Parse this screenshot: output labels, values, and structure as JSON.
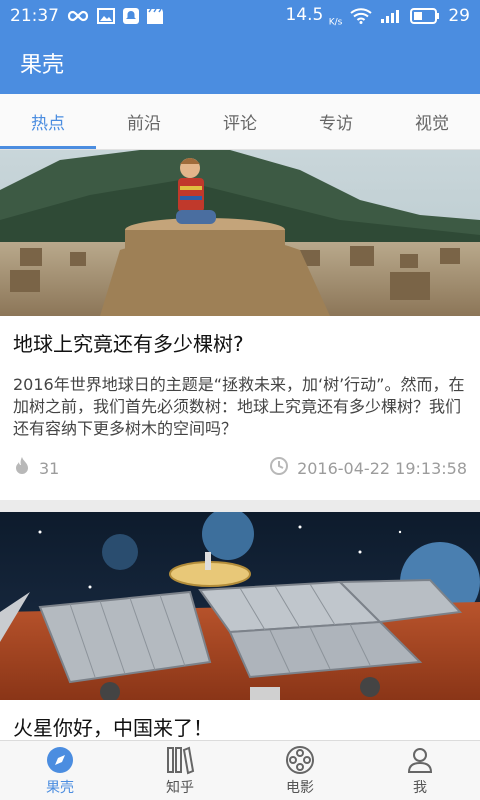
{
  "status": {
    "time": "21:37",
    "speed": "14.5",
    "speed_unit": "K/s",
    "battery": "29"
  },
  "app": {
    "title": "果壳"
  },
  "tabs": [
    {
      "label": "热点"
    },
    {
      "label": "前沿"
    },
    {
      "label": "评论"
    },
    {
      "label": "专访"
    },
    {
      "label": "视觉"
    }
  ],
  "articles": [
    {
      "title": "地球上究竟还有多少棵树?",
      "summary": "2016年世界地球日的主题是“拯救未来，加‘树’行动”。然而，在加树之前，我们首先必须数树：地球上究竟还有多少棵树？我们还有容纳下更多树木的空间吗？",
      "likes": "31",
      "date": "2016-04-22 19:13:58"
    },
    {
      "title": "火星你好，中国来了！"
    }
  ],
  "nav": [
    {
      "label": "果壳",
      "icon": "compass-icon"
    },
    {
      "label": "知乎",
      "icon": "books-icon"
    },
    {
      "label": "电影",
      "icon": "film-reel-icon"
    },
    {
      "label": "我",
      "icon": "person-icon"
    }
  ],
  "colors": {
    "accent": "#4b8de0",
    "muted": "#9c9c9c"
  }
}
